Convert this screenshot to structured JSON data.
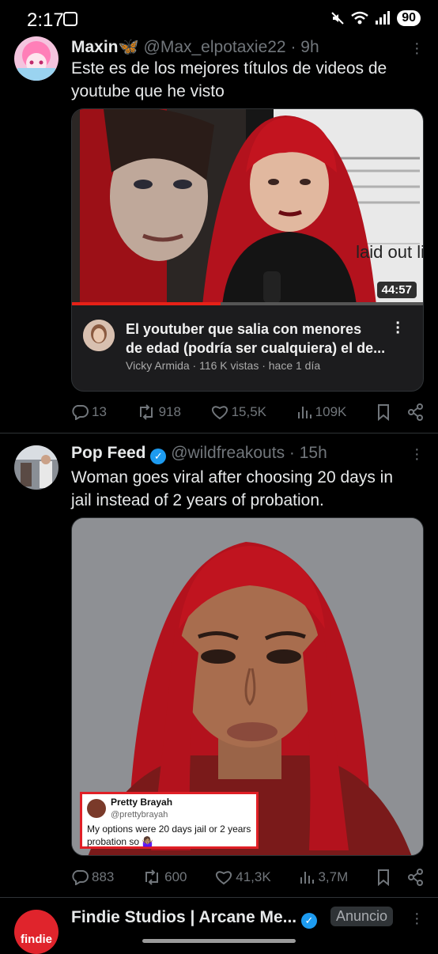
{
  "status_bar": {
    "time": "2:17",
    "battery": "90"
  },
  "tweets": [
    {
      "name": "Maxin",
      "handle": "@Max_elpotaxie22",
      "time": "· 9h",
      "text_line1": "Este es de los mejores títulos de videos de",
      "text_line2": "youtube que he visto",
      "video": {
        "duration": "44:57",
        "thumbnail_caption": "laid out li",
        "title_line1": "El youtuber que salia con menores",
        "title_line2": "de edad (podría ser cualquiera) el de...",
        "meta": "Vicky Armida · 116 K vistas · hace 1 día"
      },
      "replies": "13",
      "reposts": "918",
      "likes": "15,5K",
      "views": "109K"
    },
    {
      "name": "Pop Feed",
      "handle": "@wildfreakouts",
      "time": "· 15h",
      "text_line1": "Woman goes viral after choosing 20 days in",
      "text_line2": "jail instead of 2 years of probation.",
      "embedded": {
        "name": "Pretty Brayah",
        "handle": "@prettybrayah",
        "text_line1": "My options were 20 days jail or 2 years",
        "text_line2": "probation so 🤷🏽‍♀️"
      },
      "replies": "883",
      "reposts": "600",
      "likes": "41,3K",
      "views": "3,7M"
    },
    {
      "name": "Findie Studios | Arcane Me...",
      "badge": "Anuncio",
      "avatar_text": "findie"
    }
  ],
  "colors": {
    "background": "#000000",
    "secondary": "#71767b",
    "verified": "#1d9bf0",
    "red_hair": "#b3121d"
  }
}
